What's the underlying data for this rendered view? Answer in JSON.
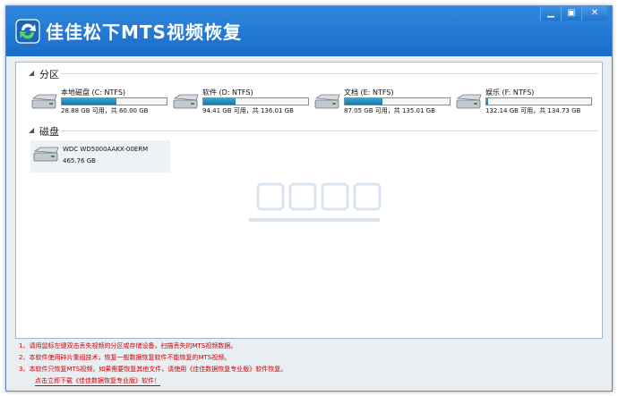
{
  "app": {
    "title": "佳佳松下MTS视频恢复",
    "minimize_glyph": "▁",
    "restore_glyph": "▣",
    "close_glyph": "✕"
  },
  "partitions": {
    "label": "分区",
    "items": [
      {
        "name": "本地磁盘 (C: NTFS)",
        "size": "28.88 GB 可用，共 60.00 GB",
        "used_fraction": 0.52
      },
      {
        "name": "软件 (D: NTFS)",
        "size": "94.41 GB 可用，共 136.01 GB",
        "used_fraction": 0.31
      },
      {
        "name": "文档 (E: NTFS)",
        "size": "87.05 GB 可用，共 135.01 GB",
        "used_fraction": 0.36
      },
      {
        "name": "娱乐 (F: NTFS)",
        "size": "132.14 GB 可用，共 134.73 GB",
        "used_fraction": 0.02
      }
    ]
  },
  "disks": {
    "label": "磁盘",
    "items": [
      {
        "name": "WDC WD5000AAKX-00ERM",
        "size": "465.76 GB"
      }
    ]
  },
  "notes": {
    "lines": [
      "1、请用鼠标左键双击丢失视频的分区或存储设备，扫描丢失的MTS视频数据。",
      "2、本软件使用碎片重组技术，恢复一般数据恢复软件不能恢复的MTS视频。",
      "3、本软件只恢复MTS视频，如果需要恢复其他文件，请使用《佳佳数据恢复专业版》软件恢复。"
    ],
    "link": "点击立即下载《佳佳数据恢复专业版》软件！"
  },
  "colors": {
    "titlebar": "#1a6ec9",
    "progress": "#1677a8",
    "note_text": "#d10000"
  }
}
